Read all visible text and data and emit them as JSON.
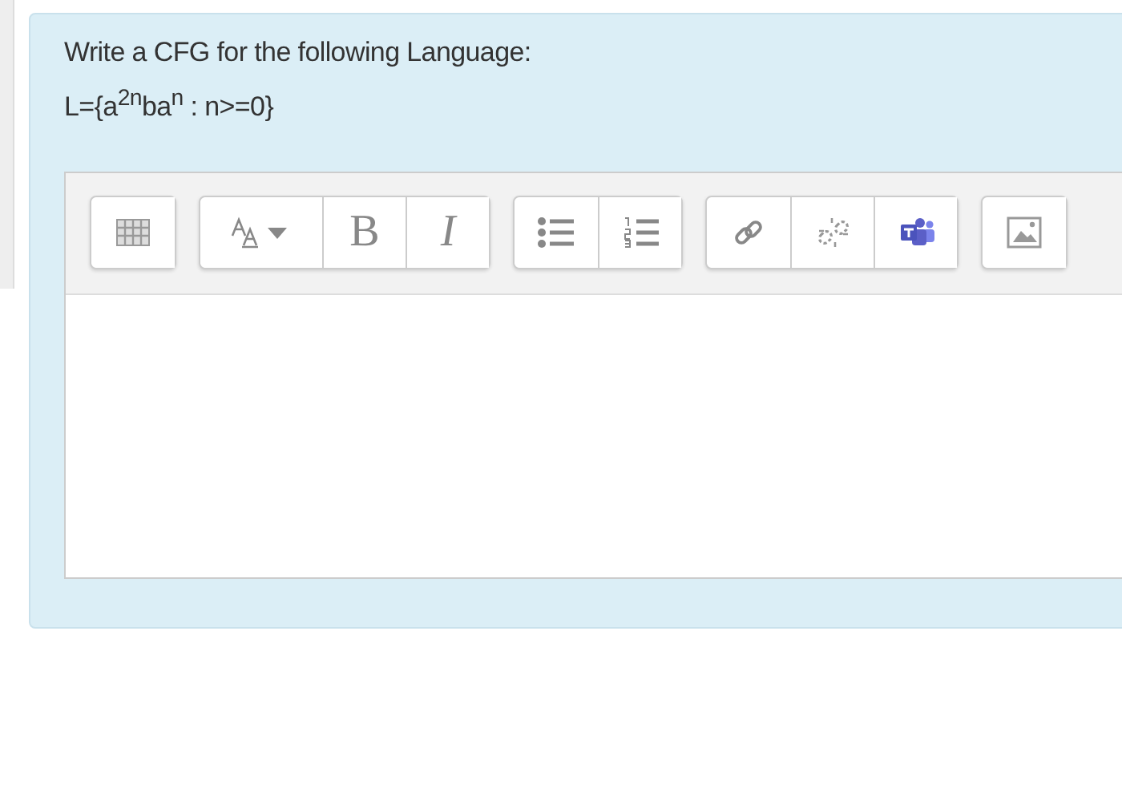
{
  "question": {
    "title": "Write a CFG for the following Language:",
    "formula": "L={a$^{2n}$ba$^{n}$ : n>=0}"
  },
  "editor": {
    "toolbar": [
      {
        "buttons": [
          {
            "kind": "table"
          }
        ]
      },
      {
        "buttons": [
          {
            "kind": "font"
          },
          {
            "kind": "bold",
            "label": "B"
          },
          {
            "kind": "italic",
            "label": "I"
          }
        ]
      },
      {
        "buttons": [
          {
            "kind": "bullets"
          },
          {
            "kind": "numbers"
          }
        ]
      },
      {
        "buttons": [
          {
            "kind": "link"
          },
          {
            "kind": "unlink"
          },
          {
            "kind": "teams"
          }
        ]
      },
      {
        "buttons": [
          {
            "kind": "image"
          }
        ]
      }
    ]
  }
}
